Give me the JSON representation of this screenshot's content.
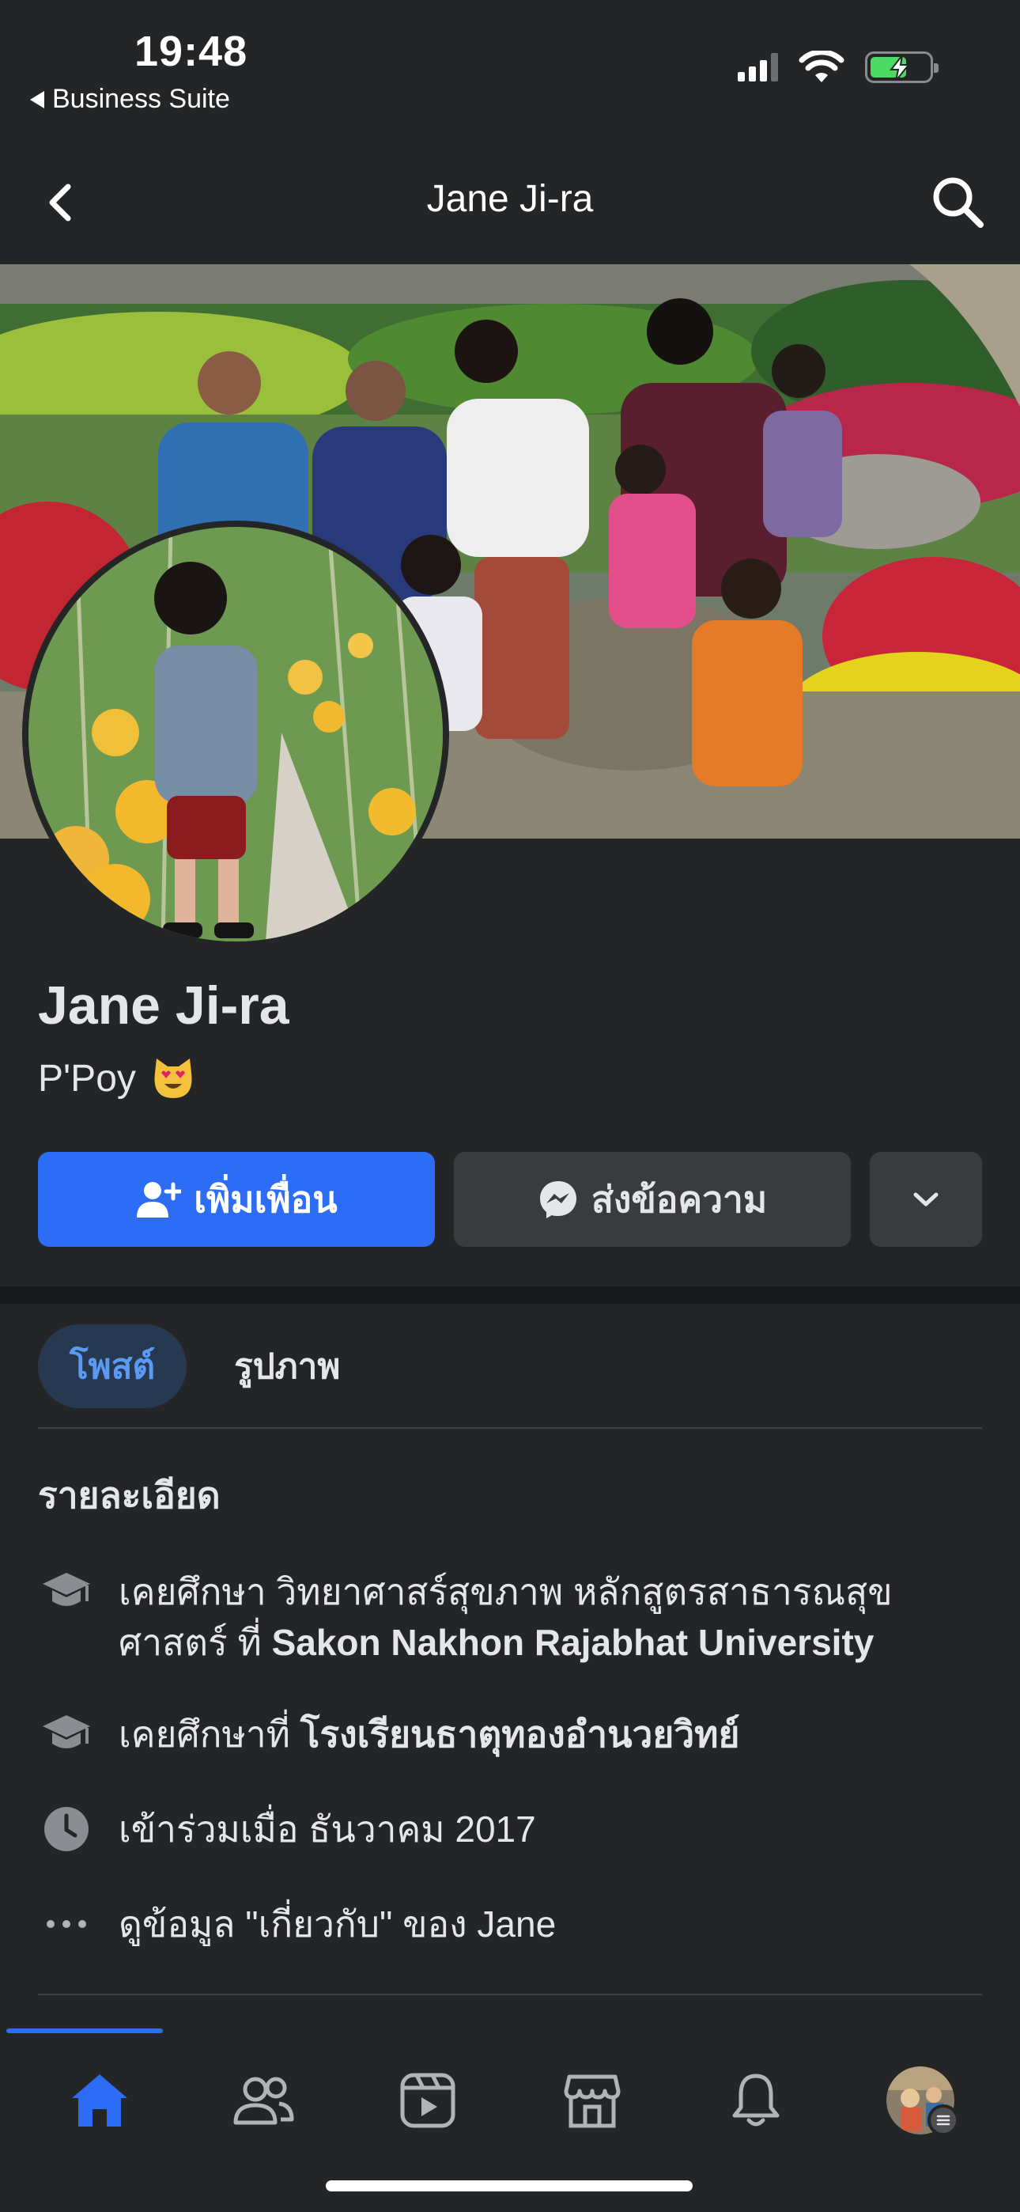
{
  "status_bar": {
    "time": "19:48",
    "back_app": "Business Suite"
  },
  "nav": {
    "title": "Jane Ji-ra"
  },
  "profile": {
    "name": "Jane Ji-ra",
    "nickname": "P'Poy"
  },
  "actions": {
    "add_friend": "เพิ่มเพื่อน",
    "message": "ส่งข้อความ"
  },
  "tabs": {
    "posts": "โพสต์",
    "photos": "รูปภาพ"
  },
  "details": {
    "title": "รายละเอียด",
    "education_1_prefix": "เคยศึกษา วิทยาศาสร์สุขภาพ หลักสูตรสาธารณสุขศาสตร์ ที่ ",
    "education_1_school": "Sakon Nakhon Rajabhat University",
    "education_2_prefix": "เคยศึกษาที่ ",
    "education_2_school": "โรงเรียนธาตุทองอำนวยวิทย์",
    "joined": "เข้าร่วมเมื่อ ธันวาคม  2017",
    "about_link": "ดูข้อมูล \"เกี่ยวกับ\" ของ Jane"
  },
  "icons": {
    "education": "graduation-cap-icon",
    "joined": "clock-icon",
    "more": "ellipsis-icon"
  },
  "colors": {
    "background": "#242526",
    "primary_blue": "#2d6cf5",
    "active_tab_bg": "#263951",
    "active_tab_text": "#5a9af5"
  }
}
